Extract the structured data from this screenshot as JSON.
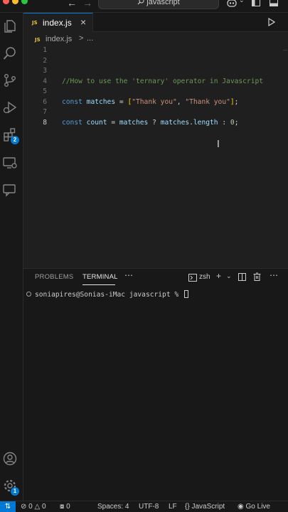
{
  "window": {
    "search_label": "javascript",
    "back_icon": "arrow-left-icon",
    "forward_icon": "arrow-right-icon"
  },
  "activity_bar": {
    "items": [
      {
        "name": "explorer",
        "icon": "files-icon"
      },
      {
        "name": "search",
        "icon": "search-icon"
      },
      {
        "name": "source-control",
        "icon": "source-control-icon"
      },
      {
        "name": "run-debug",
        "icon": "run-debug-icon"
      },
      {
        "name": "extensions",
        "icon": "extensions-icon",
        "badge": "2"
      },
      {
        "name": "remote-explorer",
        "icon": "remote-explorer-icon"
      },
      {
        "name": "chat",
        "icon": "chat-icon"
      }
    ],
    "bottom": [
      {
        "name": "accounts",
        "icon": "account-icon"
      },
      {
        "name": "manage",
        "icon": "gear-icon",
        "badge": "1"
      }
    ]
  },
  "tabs": [
    {
      "label": "index.js",
      "lang_badge": "JS",
      "active": true
    }
  ],
  "breadcrumb": {
    "lang_badge": "JS",
    "file": "index.js",
    "separator": ">",
    "more": "..."
  },
  "editor": {
    "active_line": 8,
    "lines": [
      {
        "number": "1",
        "text": ""
      },
      {
        "number": "2",
        "text": ""
      },
      {
        "number": "3",
        "text": ""
      },
      {
        "number": "4",
        "text": "//How to use the 'ternary' operator in Javascript"
      },
      {
        "number": "5",
        "text": ""
      },
      {
        "number": "6",
        "text": "const matches = [\"Thank you\", \"Thank you\"];"
      },
      {
        "number": "7",
        "text": ""
      },
      {
        "number": "8",
        "text": "const count = matches ? matches.length : 0;"
      }
    ],
    "tokens": {
      "line4": {
        "comment": "//How to use the 'ternary' operator in Javascript"
      },
      "line6": {
        "kw": "const",
        "var": "matches",
        "eq": "=",
        "open": "[",
        "str1": "\"Thank you\"",
        "comma": ", ",
        "str2": "\"Thank you\"",
        "close": "]",
        "semi": ";"
      },
      "line8": {
        "kw": "const",
        "var": "count",
        "eq": "=",
        "var2": "matches",
        "q": "?",
        "var3": "matches",
        "dot": ".",
        "prop": "length",
        "colon": ":",
        "num": "0",
        "semi": ";"
      }
    }
  },
  "panel": {
    "tabs": [
      {
        "label": "PROBLEMS",
        "active": false
      },
      {
        "label": "TERMINAL",
        "active": true
      }
    ],
    "more": "⋯",
    "shell": "zsh",
    "terminal_prompt": "soniapires@Sonias-iMac javascript % "
  },
  "status_bar": {
    "errors": "0",
    "warnings": "0",
    "ports": "0",
    "spaces": "Spaces: 4",
    "encoding": "UTF-8",
    "eol": "LF",
    "braces": "{}",
    "language": "JavaScript",
    "go_live": "Go Live"
  },
  "colors": {
    "accent": "#0078d4",
    "editor_bg": "#1f1f1f",
    "chrome_bg": "#181818",
    "comment": "#6a9955",
    "keyword": "#569cd6",
    "variable": "#9cdcfe",
    "string": "#ce9178",
    "number": "#b5cea8"
  }
}
